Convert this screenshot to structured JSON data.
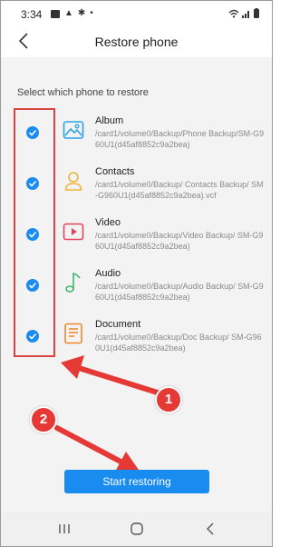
{
  "status_bar": {
    "time": "3:34"
  },
  "app_bar": {
    "title": "Restore phone"
  },
  "section_title": "Select which phone to restore",
  "items": [
    {
      "name": "Album",
      "path": "/card1/volume0/Backup/Phone Backup/SM-G960U1(d45af8852c9a2bea)",
      "icon": "album-icon",
      "checked": true
    },
    {
      "name": "Contacts",
      "path": "/card1/volume0/Backup/ Contacts Backup/ SM-G960U1(d45af8852c9a2bea).vcf",
      "icon": "contacts-icon",
      "checked": true
    },
    {
      "name": "Video",
      "path": "/card1/volume0/Backup/Video Backup/ SM-G960U1(d45af8852c9a2bea)",
      "icon": "video-icon",
      "checked": true
    },
    {
      "name": "Audio",
      "path": "/card1/volume0/Backup/Audio Backup/ SM-G960U1(d45af8852c9a2bea)",
      "icon": "audio-icon",
      "checked": true
    },
    {
      "name": "Document",
      "path": "/card1/volume0/Backup/Doc Backup/ SM-G960U1(d45af8852c9a2bea)",
      "icon": "document-icon",
      "checked": true
    }
  ],
  "start_button": "Start restoring",
  "annotations": {
    "badge_1": "1",
    "badge_2": "2"
  },
  "colors": {
    "accent": "#1a8cf0",
    "annotation_red": "#e53935",
    "album_icon": "#2ba3e8",
    "contacts_icon": "#f0b43a",
    "video_icon": "#e2455b",
    "audio_icon": "#3cb66a",
    "document_icon": "#f08a2c"
  }
}
